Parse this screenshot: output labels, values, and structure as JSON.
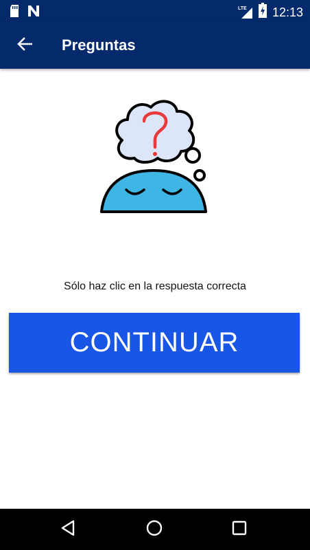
{
  "status_bar": {
    "time": "12:13",
    "network_label": "LTE",
    "icons": [
      "sd-card-icon",
      "n-notification-icon",
      "signal-icon",
      "battery-charging-icon"
    ]
  },
  "app_bar": {
    "title": "Preguntas",
    "back_icon": "arrow-left-icon"
  },
  "illustration": {
    "icon": "thinking-head-question-icon",
    "colors": {
      "head": "#3eb5e5",
      "bubble": "#dde5f8",
      "question_mark": "#e83a3a",
      "outline": "#000000"
    }
  },
  "main": {
    "instruction": "Sólo haz clic en la respuesta correcta",
    "continue_label": "CONTINUAR"
  },
  "nav_bar": {
    "icons": [
      "back-triangle-icon",
      "home-circle-icon",
      "recents-square-icon"
    ]
  },
  "colors": {
    "primary_dark": "#052a6b",
    "button_blue": "#1a56e6",
    "nav_bar": "#000000"
  }
}
